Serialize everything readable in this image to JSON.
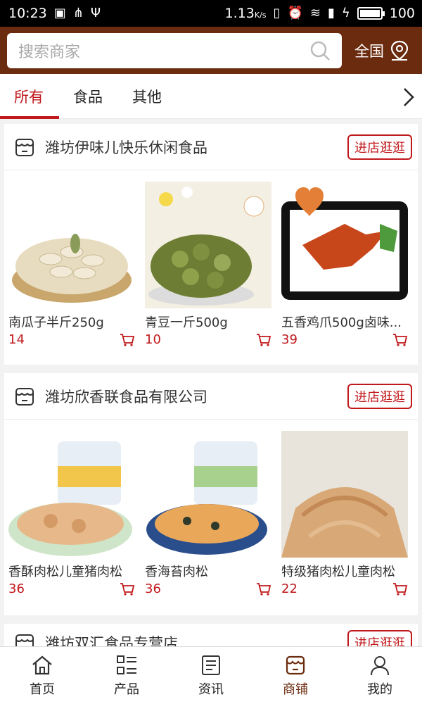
{
  "status_bar": {
    "time": "10:23",
    "speed": "1.13",
    "speed_unit": "K/s",
    "battery": "100"
  },
  "header": {
    "search_placeholder": "搜索商家",
    "region": "全国"
  },
  "tabs": [
    {
      "label": "所有"
    },
    {
      "label": "食品"
    },
    {
      "label": "其他"
    }
  ],
  "enter_label": "进店逛逛",
  "shops": [
    {
      "name": "潍坊伊味儿快乐休闲食品",
      "products": [
        {
          "name": "南瓜子半斤250g",
          "price": "14"
        },
        {
          "name": "青豆一斤500g",
          "price": "10"
        },
        {
          "name": "五香鸡爪500g卤味...",
          "price": "39"
        }
      ]
    },
    {
      "name": "潍坊欣香联食品有限公司",
      "products": [
        {
          "name": "香酥肉松儿童猪肉松",
          "price": "36"
        },
        {
          "name": "香海苔肉松",
          "price": "36"
        },
        {
          "name": "特级猪肉松儿童肉松",
          "price": "22"
        }
      ]
    },
    {
      "name": "潍坊双汇食品专营店"
    }
  ],
  "bottom_nav": [
    {
      "label": "首页",
      "icon": "home-icon"
    },
    {
      "label": "产品",
      "icon": "list-icon"
    },
    {
      "label": "资讯",
      "icon": "news-icon"
    },
    {
      "label": "商铺",
      "icon": "shop-icon"
    },
    {
      "label": "我的",
      "icon": "user-icon"
    }
  ],
  "colors": {
    "brand": "#6b2b0f",
    "accent": "#c0181b"
  }
}
